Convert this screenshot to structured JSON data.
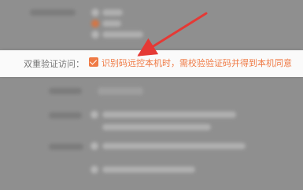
{
  "row": {
    "label": "双重验证访问：",
    "checkbox_checked": true,
    "description": "识别码远控本机时，需校验验证码并得到本机同意"
  },
  "colors": {
    "background": "#8f8f8f",
    "focus_bar": "#fafafa",
    "label_text": "#777777",
    "accent": "#ef7a45",
    "arrow": "#e53935"
  },
  "icons": {
    "checkbox": "checkbox-checked-icon",
    "annotation": "red-arrow-icon"
  }
}
